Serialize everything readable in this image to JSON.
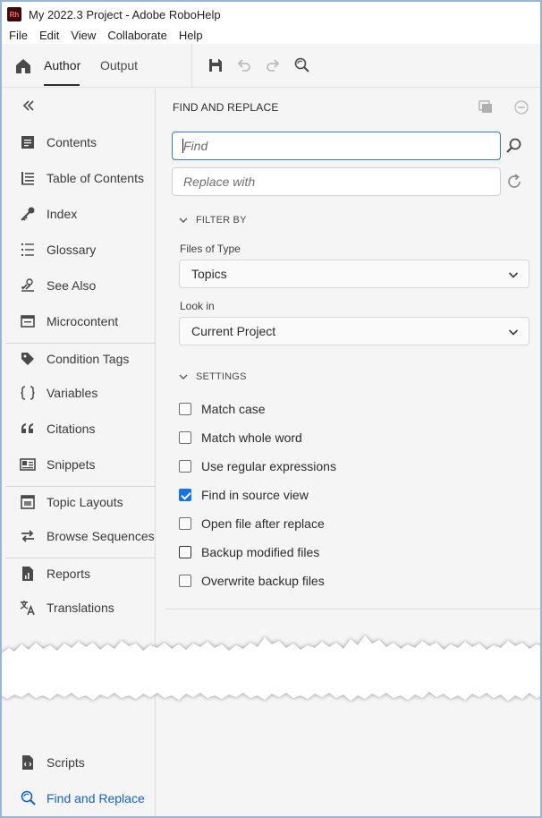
{
  "window": {
    "logo_text": "Rh",
    "title": "My 2022.3 Project - Adobe RoboHelp"
  },
  "menu": [
    "File",
    "Edit",
    "View",
    "Collaborate",
    "Help"
  ],
  "toolbar": {
    "tabs": [
      "Author",
      "Output"
    ],
    "active_tab": "Author",
    "icons": [
      "save-icon",
      "undo-icon",
      "redo-icon",
      "find-replace-icon"
    ]
  },
  "sidebar": {
    "items": [
      {
        "label": "Contents",
        "icon": "contents-icon"
      },
      {
        "label": "Table of Contents",
        "icon": "toc-icon"
      },
      {
        "label": "Index",
        "icon": "key-icon"
      },
      {
        "label": "Glossary",
        "icon": "glossary-icon"
      },
      {
        "label": "See Also",
        "icon": "see-also-icon"
      },
      {
        "label": "Microcontent",
        "icon": "microcontent-icon"
      },
      {
        "label": "Condition Tags",
        "icon": "tag-icon"
      },
      {
        "label": "Variables",
        "icon": "braces-icon"
      },
      {
        "label": "Citations",
        "icon": "quote-icon"
      },
      {
        "label": "Snippets",
        "icon": "snippets-icon"
      },
      {
        "label": "Topic Layouts",
        "icon": "layout-icon"
      },
      {
        "label": "Browse Sequences",
        "icon": "arrows-icon"
      },
      {
        "label": "Reports",
        "icon": "report-icon"
      },
      {
        "label": "Translations",
        "icon": "translate-icon"
      },
      {
        "label": "Scripts",
        "icon": "script-icon"
      },
      {
        "label": "Find and Replace",
        "icon": "find-replace-icon"
      }
    ],
    "active_item": "Find and Replace"
  },
  "panel": {
    "title": "FIND AND REPLACE",
    "find_placeholder": "Find",
    "replace_placeholder": "Replace with",
    "filter_by": "FILTER BY",
    "files_of_type_label": "Files of Type",
    "files_of_type_value": "Topics",
    "look_in_label": "Look in",
    "look_in_value": "Current Project",
    "settings": "SETTINGS",
    "options": [
      {
        "label": "Match case",
        "checked": false
      },
      {
        "label": "Match whole word",
        "checked": false
      },
      {
        "label": "Use regular expressions",
        "checked": false
      },
      {
        "label": "Find in source view",
        "checked": true
      },
      {
        "label": "Open file after replace",
        "checked": false
      },
      {
        "label": "Backup modified files",
        "checked": false
      },
      {
        "label": "Overwrite backup files",
        "checked": false
      }
    ]
  },
  "colors": {
    "accent": "#1473e6",
    "active_nav": "#1461c7",
    "frame_border": "#9ab6d6"
  }
}
